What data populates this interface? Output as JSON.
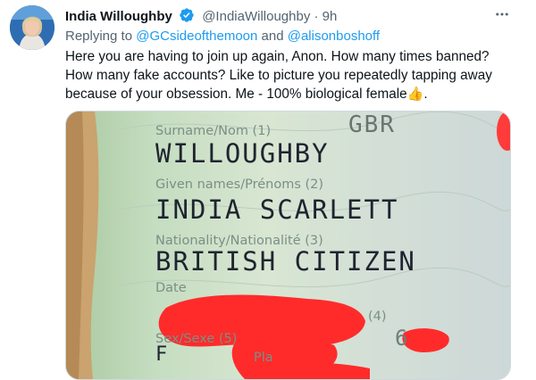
{
  "author": {
    "display_name": "India Willoughby",
    "handle": "@IndiaWilloughby",
    "separator": "·",
    "time": "9h"
  },
  "reply": {
    "prefix": "Replying to",
    "mention1": "@GCsideofthemoon",
    "joiner": "and",
    "mention2": "@alisonboshoff"
  },
  "tweet": {
    "text": "Here you are having to join up again, Anon. How many times banned? How many fake accounts? Like to picture you repeatedly tapping away because of your obsession. Me - 100% biological female",
    "emoji": "👍",
    "end": "."
  },
  "media": {
    "country_code": "GBR",
    "surname_label": "Surname/Nom (1)",
    "surname_value": "WILLOUGHBY",
    "given_label": "Given names/Prénoms (2)",
    "given_value": "INDIA SCARLETT",
    "nationality_label": "Nationality/Nationalité (3)",
    "nationality_value": "BRITISH CITIZEN",
    "date_label": "Date",
    "field4_number": "(4)",
    "sex_label": "Sex/Sexe (5)",
    "sex_value": "F",
    "place_label": "Pla",
    "partial_value": "6"
  },
  "colors": {
    "link": "#1d9bf0",
    "verified": "#1d9bf0",
    "redaction": "#ff2b2b"
  }
}
